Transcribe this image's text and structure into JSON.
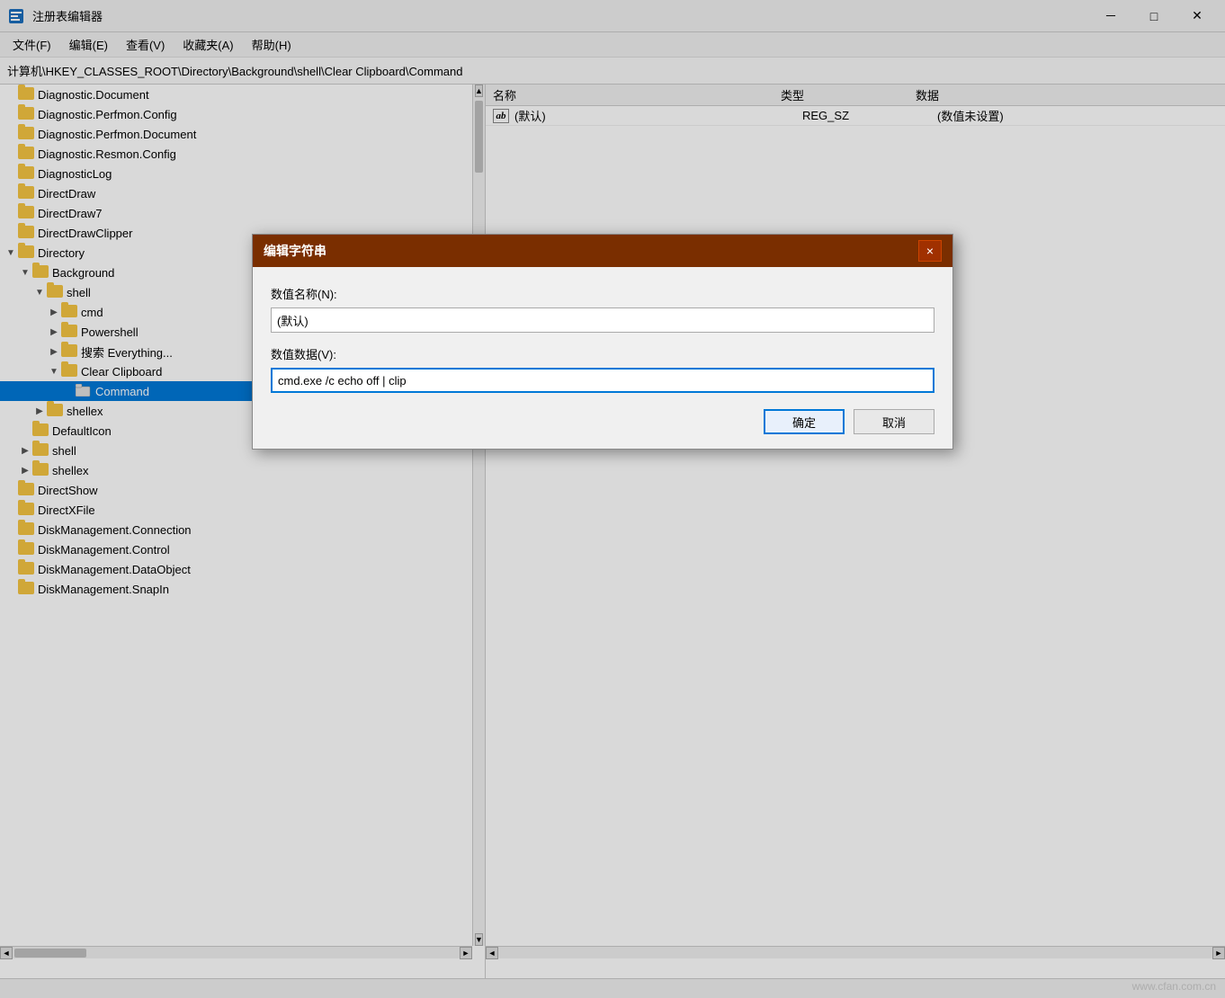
{
  "titlebar": {
    "icon_label": "regedit-icon",
    "title": "注册表编辑器",
    "minimize_label": "－",
    "maximize_label": "□",
    "close_label": "✕"
  },
  "menubar": {
    "items": [
      {
        "label": "文件(F)"
      },
      {
        "label": "编辑(E)"
      },
      {
        "label": "查看(V)"
      },
      {
        "label": "收藏夹(A)"
      },
      {
        "label": "帮助(H)"
      }
    ]
  },
  "addressbar": {
    "path": "计算机\\HKEY_CLASSES_ROOT\\Directory\\Background\\shell\\Clear Clipboard\\Command"
  },
  "tree": {
    "items": [
      {
        "label": "Diagnostic.Document",
        "indent": 0,
        "expanded": false,
        "has_children": false,
        "type": "folder"
      },
      {
        "label": "Diagnostic.Perfmon.Config",
        "indent": 0,
        "expanded": false,
        "has_children": false,
        "type": "folder"
      },
      {
        "label": "Diagnostic.Perfmon.Document",
        "indent": 0,
        "expanded": false,
        "has_children": false,
        "type": "folder"
      },
      {
        "label": "Diagnostic.Resmon.Config",
        "indent": 0,
        "expanded": false,
        "has_children": false,
        "type": "folder"
      },
      {
        "label": "DiagnosticLog",
        "indent": 0,
        "expanded": false,
        "has_children": false,
        "type": "folder"
      },
      {
        "label": "DirectDraw",
        "indent": 0,
        "expanded": false,
        "has_children": false,
        "type": "folder"
      },
      {
        "label": "DirectDraw7",
        "indent": 0,
        "expanded": false,
        "has_children": false,
        "type": "folder"
      },
      {
        "label": "DirectDrawClipper",
        "indent": 0,
        "expanded": false,
        "has_children": false,
        "type": "folder"
      },
      {
        "label": "Directory",
        "indent": 0,
        "expanded": true,
        "has_children": true,
        "type": "folder"
      },
      {
        "label": "Background",
        "indent": 1,
        "expanded": true,
        "has_children": true,
        "type": "folder"
      },
      {
        "label": "shell",
        "indent": 2,
        "expanded": true,
        "has_children": true,
        "type": "folder"
      },
      {
        "label": "cmd",
        "indent": 3,
        "expanded": false,
        "has_children": true,
        "type": "folder"
      },
      {
        "label": "Powershell",
        "indent": 3,
        "expanded": false,
        "has_children": true,
        "type": "folder"
      },
      {
        "label": "搜索 Everything...",
        "indent": 3,
        "expanded": false,
        "has_children": true,
        "type": "folder"
      },
      {
        "label": "Clear Clipboard",
        "indent": 3,
        "expanded": true,
        "has_children": true,
        "type": "folder"
      },
      {
        "label": "Command",
        "indent": 4,
        "expanded": false,
        "has_children": false,
        "type": "folder",
        "selected": true
      },
      {
        "label": "shellex",
        "indent": 2,
        "expanded": false,
        "has_children": true,
        "type": "folder"
      },
      {
        "label": "DefaultIcon",
        "indent": 1,
        "expanded": false,
        "has_children": false,
        "type": "folder"
      },
      {
        "label": "shell",
        "indent": 1,
        "expanded": false,
        "has_children": true,
        "type": "folder"
      },
      {
        "label": "shellex",
        "indent": 1,
        "expanded": false,
        "has_children": true,
        "type": "folder"
      },
      {
        "label": "DirectShow",
        "indent": 0,
        "expanded": false,
        "has_children": false,
        "type": "folder"
      },
      {
        "label": "DirectXFile",
        "indent": 0,
        "expanded": false,
        "has_children": false,
        "type": "folder"
      },
      {
        "label": "DiskManagement.Connection",
        "indent": 0,
        "expanded": false,
        "has_children": false,
        "type": "folder"
      },
      {
        "label": "DiskManagement.Control",
        "indent": 0,
        "expanded": false,
        "has_children": false,
        "type": "folder"
      },
      {
        "label": "DiskManagement.DataObject",
        "indent": 0,
        "expanded": false,
        "has_children": false,
        "type": "folder"
      },
      {
        "label": "DiskManagement.SnapIn",
        "indent": 0,
        "expanded": false,
        "has_children": false,
        "type": "folder"
      }
    ]
  },
  "rightpane": {
    "columns": [
      "名称",
      "类型",
      "数据"
    ],
    "rows": [
      {
        "icon": "ab",
        "name": "(默认)",
        "type": "REG_SZ",
        "data": "(数值未设置)"
      }
    ]
  },
  "dialog": {
    "title": "编辑字符串",
    "close_btn": "×",
    "name_label": "数值名称(N):",
    "name_value": "(默认)",
    "data_label": "数值数据(V):",
    "data_value": "cmd.exe /c echo off | clip",
    "ok_label": "确定",
    "cancel_label": "取消"
  },
  "watermark": "www.cfan.com.cn",
  "cursor": {
    "label": "cursor-arrow"
  }
}
